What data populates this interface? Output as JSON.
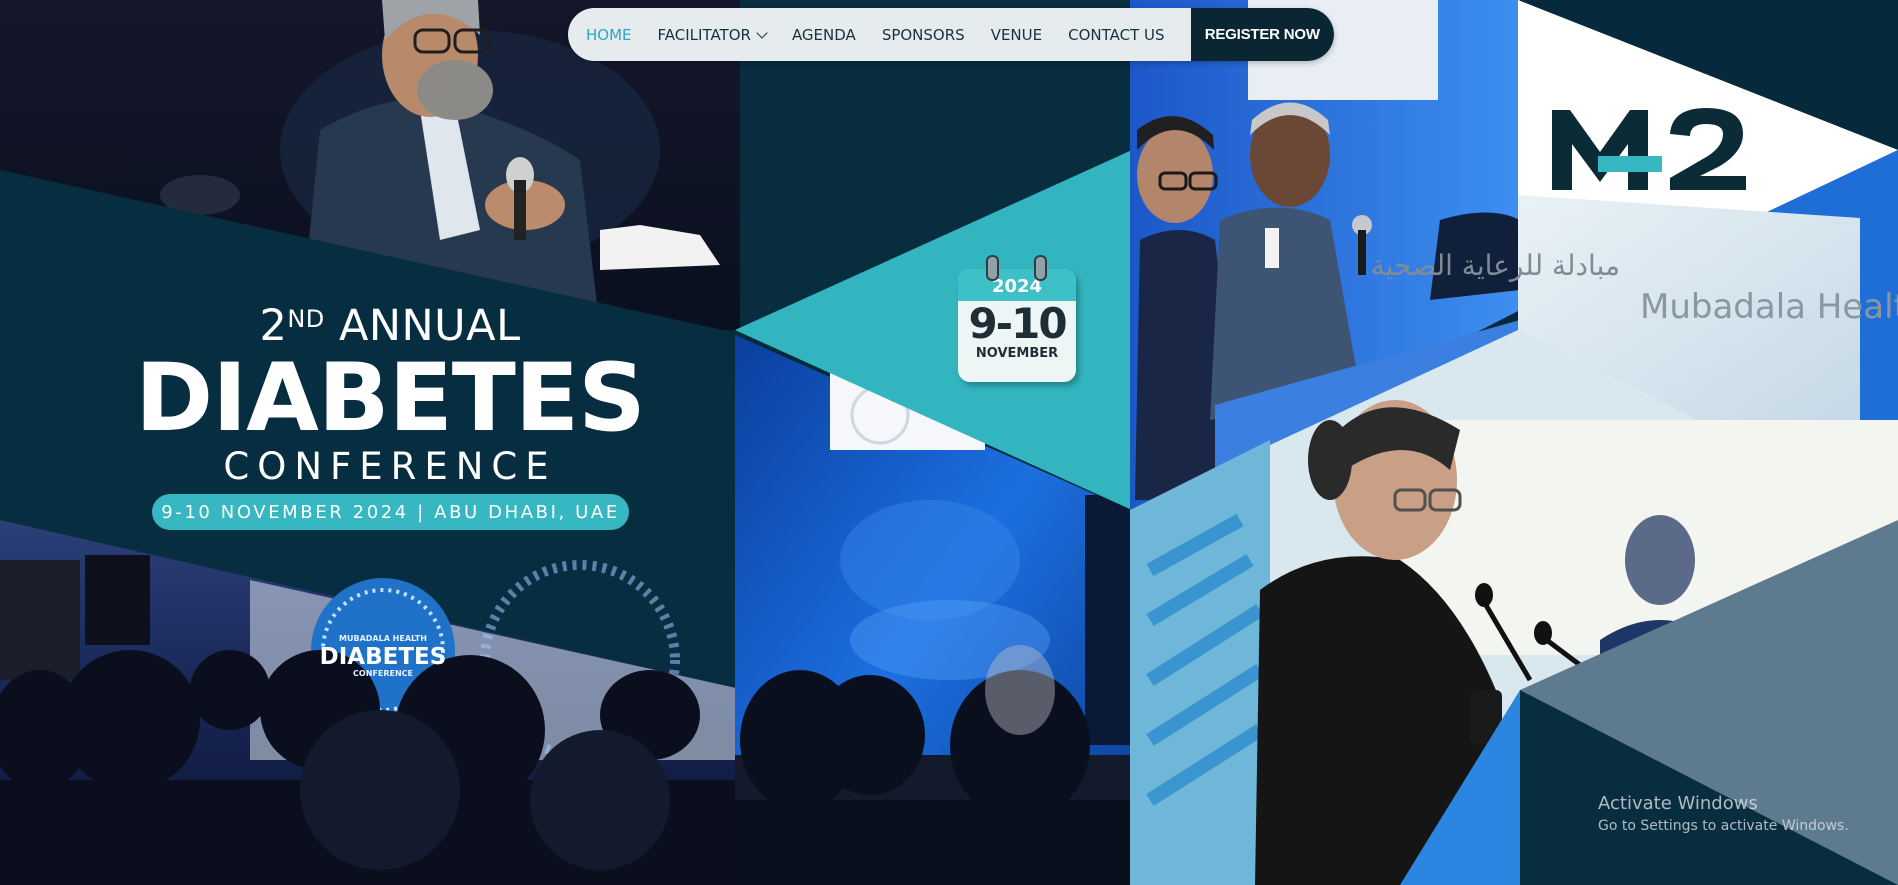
{
  "nav": {
    "items": [
      {
        "label": "HOME",
        "active": true
      },
      {
        "label": "FACILITATOR",
        "dropdown": true
      },
      {
        "label": "AGENDA"
      },
      {
        "label": "SPONSORS"
      },
      {
        "label": "VENUE"
      },
      {
        "label": "CONTACT US"
      }
    ],
    "register_label": "REGISTER NOW"
  },
  "hero": {
    "ordinal_number": "2",
    "ordinal_suffix": "ND",
    "annual": "ANNUAL",
    "title": "DIABETES",
    "subtitle": "CONFERENCE",
    "date_location": "9-10 NOVEMBER 2024 | ABU DHABI, UAE"
  },
  "calendar": {
    "year": "2024",
    "range": "9-10",
    "month": "NOVEMBER"
  },
  "logo": {
    "text": "M2"
  },
  "photos": {
    "backdrop_logo_line1": "MUBADALA HEALTH",
    "backdrop_logo_line2": "DIABETES",
    "backdrop_logo_line3": "CONFERENCE",
    "sign_text_arabic": "مبادلة للرعاية الصحية",
    "sign_text": "Mubadala Health"
  },
  "os_watermark": {
    "line1": "Activate Windows",
    "line2": "Go to Settings to activate Windows."
  },
  "colors": {
    "navy": "#062a3b",
    "teal": "#36b7c2",
    "accent_active": "#2aa8c0",
    "register_bg": "#0b2633"
  }
}
